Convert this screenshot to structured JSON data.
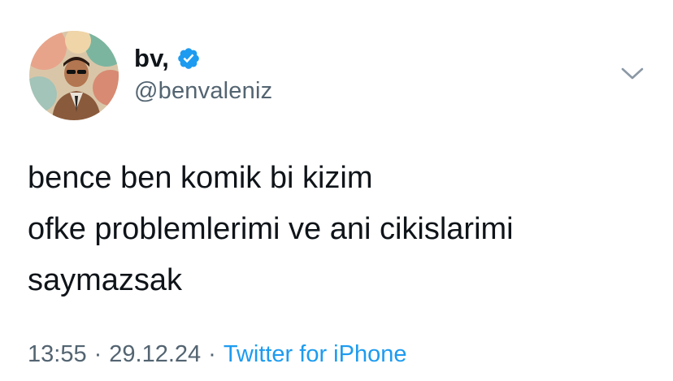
{
  "author": {
    "display_name": "bv,",
    "handle": "@benvaleniz",
    "verified": true,
    "verified_color": "#1d9bf0"
  },
  "tweet": {
    "lines": [
      "bence ben komik bi kizim",
      "ofke problemlerimi ve ani cikislarimi",
      "saymazsak"
    ],
    "time": "13:55",
    "date": "29.12.24",
    "separator": "·",
    "source": "Twitter for iPhone"
  },
  "icons": {
    "verified": "verified-badge-icon",
    "menu": "chevron-down-icon"
  },
  "colors": {
    "text": "#0f1419",
    "secondary": "#536471",
    "link": "#1d9bf0"
  }
}
